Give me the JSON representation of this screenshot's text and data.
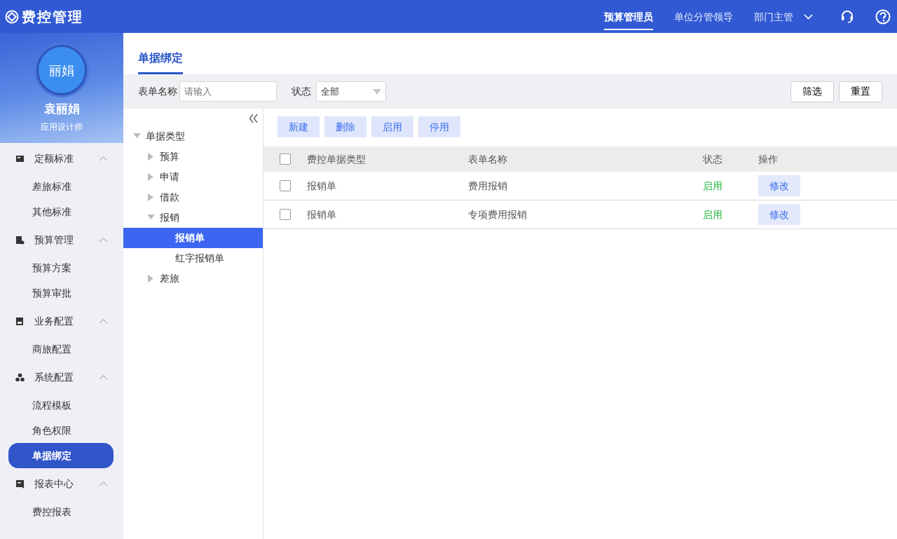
{
  "app": {
    "title": "费控管理"
  },
  "header_nav": [
    {
      "label": "预算管理员",
      "selected": true
    },
    {
      "label": "单位分管领导",
      "selected": false
    },
    {
      "label": "部门主管",
      "selected": false
    }
  ],
  "user": {
    "avatar_text": "丽娟",
    "name": "袁丽娟",
    "role": "应用设计师"
  },
  "sidebar": [
    {
      "label": "定额标准",
      "expanded": true,
      "children": [
        {
          "label": "差旅标准",
          "selected": false
        },
        {
          "label": "其他标准",
          "selected": false
        }
      ]
    },
    {
      "label": "预算管理",
      "expanded": true,
      "children": [
        {
          "label": "预算方案",
          "selected": false
        },
        {
          "label": "预算审批",
          "selected": false
        }
      ]
    },
    {
      "label": "业务配置",
      "expanded": true,
      "children": [
        {
          "label": "商旅配置",
          "selected": false
        }
      ]
    },
    {
      "label": "系统配置",
      "expanded": true,
      "children": [
        {
          "label": "流程模板",
          "selected": false
        },
        {
          "label": "角色权限",
          "selected": false
        },
        {
          "label": "单据绑定",
          "selected": true
        }
      ]
    },
    {
      "label": "报表中心",
      "expanded": true,
      "children": [
        {
          "label": "费控报表",
          "selected": false
        }
      ]
    }
  ],
  "page_tab": {
    "label": "单据绑定",
    "selected": true
  },
  "filters": {
    "form_name": {
      "label": "表单名称",
      "placeholder": "请输入"
    },
    "status": {
      "label": "状态",
      "value": "全部"
    },
    "buttons": [
      "筛选",
      "重置"
    ]
  },
  "tree": {
    "label": "单据类型",
    "expanded": true,
    "children": [
      {
        "label": "预算",
        "expanded": false
      },
      {
        "label": "申请",
        "expanded": false
      },
      {
        "label": "借款",
        "expanded": false
      },
      {
        "label": "报销",
        "expanded": true,
        "children": [
          {
            "label": "报销单",
            "selected": true
          },
          {
            "label": "红字报销单",
            "selected": false
          }
        ]
      },
      {
        "label": "差旅",
        "expanded": false
      }
    ]
  },
  "toolbar": [
    "新建",
    "删除",
    "启用",
    "停用"
  ],
  "table": {
    "all_checked": false,
    "columns": [
      "费控单据类型",
      "表单名称",
      "状态",
      "操作"
    ],
    "rows": [
      {
        "checked": false,
        "type": "报销单",
        "name": "费用报销",
        "status": "启用",
        "action": "修改"
      },
      {
        "checked": false,
        "type": "报销单",
        "name": "专项费用报销",
        "status": "启用",
        "action": "修改"
      }
    ]
  }
}
